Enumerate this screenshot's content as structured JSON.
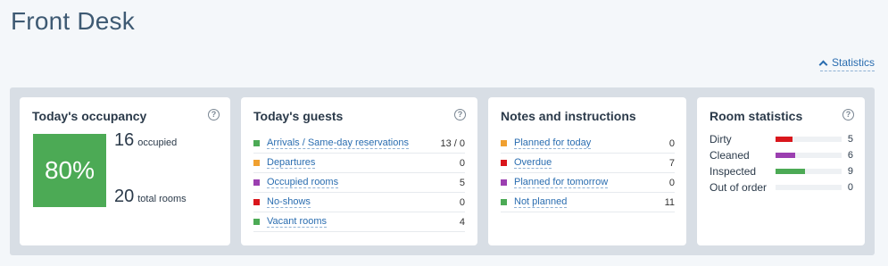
{
  "page": {
    "title": "Front Desk",
    "statistics_toggle": "Statistics"
  },
  "occupancy": {
    "title": "Today's occupancy",
    "percent": "80%",
    "occupied": "16",
    "occupied_label": "occupied",
    "total": "20",
    "total_label": "total rooms"
  },
  "guests": {
    "title": "Today's guests",
    "rows": [
      {
        "label": "Arrivals / Same-day reservations",
        "value": "13 / 0",
        "color": "#4caa55"
      },
      {
        "label": "Departures",
        "value": "0",
        "color": "#f0a030"
      },
      {
        "label": "Occupied rooms",
        "value": "5",
        "color": "#9b3fb0"
      },
      {
        "label": "No-shows",
        "value": "0",
        "color": "#d9161c"
      },
      {
        "label": "Vacant rooms",
        "value": "4",
        "color": "#4caa55"
      }
    ]
  },
  "notes": {
    "title": "Notes and instructions",
    "rows": [
      {
        "label": "Planned for today",
        "value": "0",
        "color": "#f0a030"
      },
      {
        "label": "Overdue",
        "value": "7",
        "color": "#d9161c"
      },
      {
        "label": "Planned for tomorrow",
        "value": "0",
        "color": "#9b3fb0"
      },
      {
        "label": "Not planned",
        "value": "11",
        "color": "#4caa55"
      }
    ]
  },
  "room_stats": {
    "title": "Room statistics",
    "total_rooms": 20,
    "rows": [
      {
        "label": "Dirty",
        "value": "5",
        "color": "#d9161c"
      },
      {
        "label": "Cleaned",
        "value": "6",
        "color": "#9b3fb0"
      },
      {
        "label": "Inspected",
        "value": "9",
        "color": "#4caa55"
      },
      {
        "label": "Out of order",
        "value": "0",
        "color": "#999999"
      }
    ]
  },
  "colors": {
    "occupancy_box": "#4caa55",
    "link": "#2a6db0",
    "panel_bg": "#d8dee5"
  },
  "icons": {
    "help": "question-mark-circle-icon",
    "toggle": "chevron-up-icon"
  }
}
